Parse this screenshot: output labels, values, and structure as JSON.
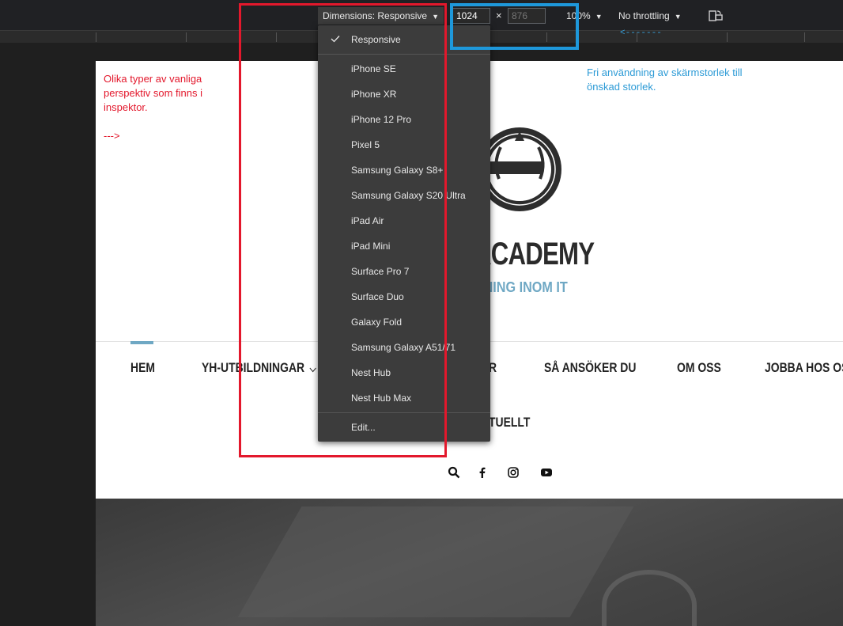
{
  "toolbar": {
    "dimensions_label": "Dimensions: Responsive",
    "width_value": "1024",
    "height_value": "876",
    "times_symbol": "×",
    "zoom_label": "100%",
    "throttle_label": "No throttling"
  },
  "dropdown": {
    "selected": "Responsive",
    "devices": [
      "iPhone SE",
      "iPhone XR",
      "iPhone 12 Pro",
      "Pixel 5",
      "Samsung Galaxy S8+",
      "Samsung Galaxy S20 Ultra",
      "iPad Air",
      "iPad Mini",
      "Surface Pro 7",
      "Surface Duo",
      "Galaxy Fold",
      "Samsung Galaxy A51/71",
      "Nest Hub",
      "Nest Hub Max"
    ],
    "edit_label": "Edit..."
  },
  "page": {
    "brand_title": "ACADEMY",
    "brand_subtitle": "ONING INOM IT",
    "nav": [
      "HEM",
      "YH-UTBILDNINGAR",
      "R",
      "SÅ ANSÖKER DU",
      "OM OSS",
      "JOBBA HOS OSS",
      "TUELLT"
    ]
  },
  "annotations": {
    "red_text": "Olika typer av vanliga perspektiv som finns i inspektor.",
    "red_arrow": "--->",
    "blue_text": "Fri användning av skärmstorlek till önskad storlek.",
    "blue_arrow": "<-------"
  },
  "colors": {
    "accent": "#6fa8c4",
    "annotation_red": "#e3182c",
    "annotation_blue": "#1e98db"
  }
}
